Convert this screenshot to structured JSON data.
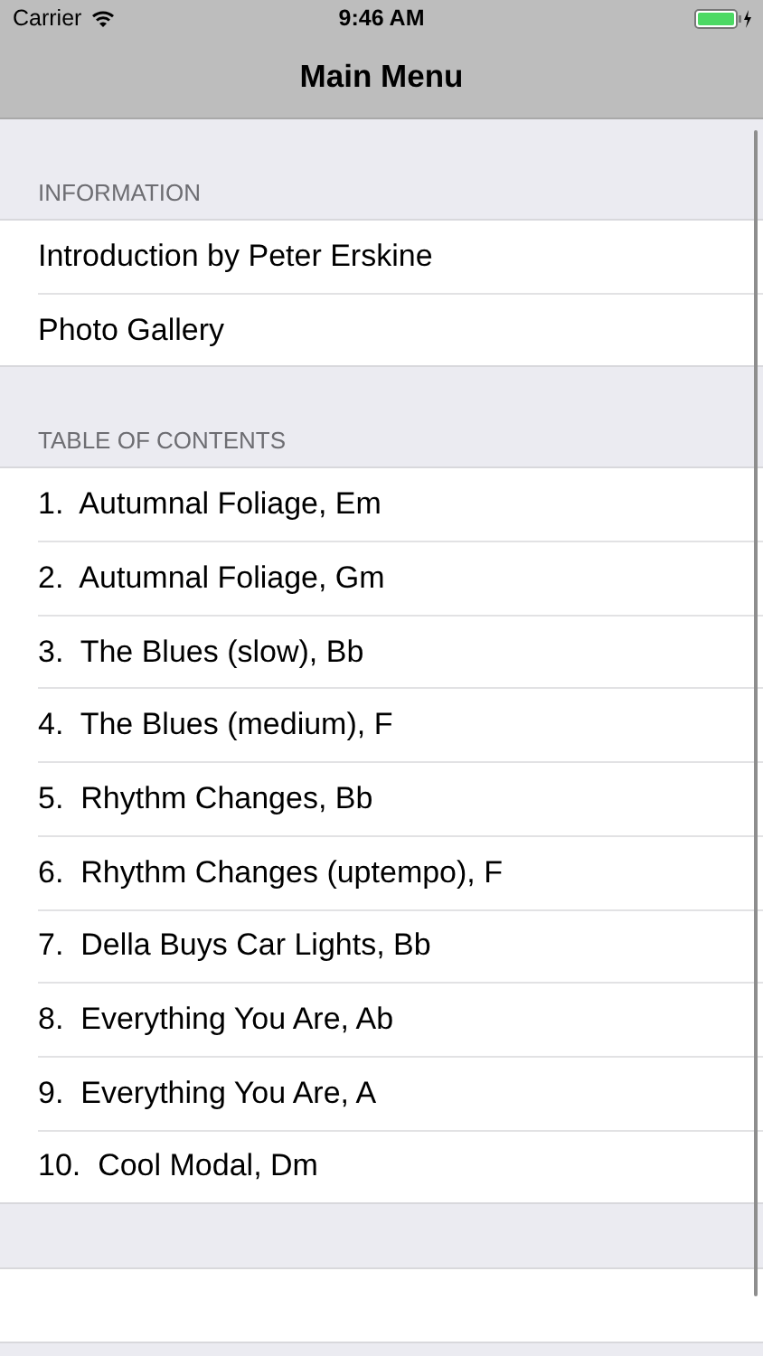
{
  "status_bar": {
    "carrier": "Carrier",
    "time": "9:46 AM"
  },
  "nav_bar": {
    "title": "Main Menu"
  },
  "sections": [
    {
      "header": "INFORMATION",
      "items": [
        {
          "label": "Introduction by Peter Erskine"
        },
        {
          "label": "Photo Gallery"
        }
      ]
    },
    {
      "header": "TABLE OF CONTENTS",
      "items": [
        {
          "label": "1.  Autumnal Foliage, Em"
        },
        {
          "label": "2.  Autumnal Foliage, Gm"
        },
        {
          "label": "3.  The Blues (slow), Bb"
        },
        {
          "label": "4.  The Blues (medium), F"
        },
        {
          "label": "5.  Rhythm Changes, Bb"
        },
        {
          "label": "6.  Rhythm Changes (uptempo), F"
        },
        {
          "label": "7.  Della Buys Car Lights, Bb"
        },
        {
          "label": "8.  Everything You Are, Ab"
        },
        {
          "label": "9.  Everything You Are, A"
        },
        {
          "label": "10.  Cool Modal, Dm"
        }
      ]
    }
  ]
}
